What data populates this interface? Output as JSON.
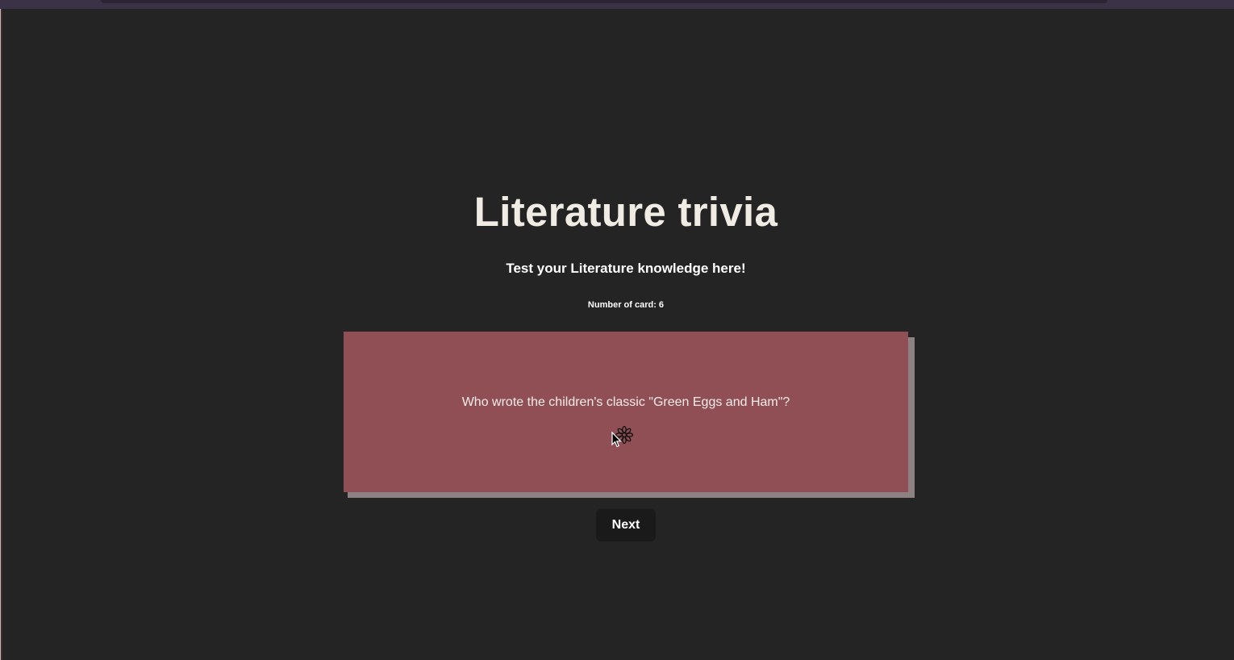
{
  "app": {
    "title": "Literature trivia",
    "subtitle": "Test your Literature knowledge here!",
    "card_count_text": "Number of card: 6"
  },
  "card": {
    "question": "Who wrote the children's classic \"Green Eggs and Ham\"?",
    "icon": "flower-icon",
    "background_color": "#904f55"
  },
  "controls": {
    "next_label": "Next"
  },
  "colors": {
    "page_background": "#242424",
    "title_text": "#f0ece4",
    "button_background": "#1a1a1a"
  }
}
